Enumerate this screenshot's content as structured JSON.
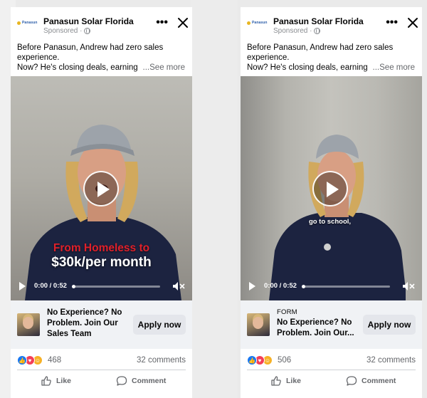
{
  "colors": {
    "brand_blue": "#1877f2",
    "overlay_red": "#e0202a",
    "secondary_text": "#65676b"
  },
  "cards": [
    {
      "logo_text": "Panasun",
      "advertiser": "Panasun Solar Florida",
      "sponsored": "Sponsored ·",
      "caption_lines": [
        "Before Panasun, Andrew had zero sales",
        "experience.",
        "Now? He's closing deals, earning"
      ],
      "see_more": "...See more",
      "video": {
        "overlay_red": "From Homeless to",
        "overlay_white": "$30k/per month",
        "subtitle": "",
        "time": "0:00 / 0:52"
      },
      "cta": {
        "kicker": "",
        "title_lines": [
          "No Experience? No",
          "Problem. Join Our",
          "Sales Team"
        ],
        "button": "Apply now"
      },
      "reactions": {
        "icons": [
          "like-icon",
          "love-icon",
          "haha-icon"
        ],
        "count": "468"
      },
      "comments": "32 comments",
      "actions": {
        "like": "Like",
        "comment": "Comment"
      }
    },
    {
      "logo_text": "Panasun",
      "advertiser": "Panasun Solar Florida",
      "sponsored": "Sponsored ·",
      "caption_lines": [
        "Before Panasun, Andrew had zero sales",
        "experience.",
        "Now? He's closing deals, earning"
      ],
      "see_more": "...See more",
      "video": {
        "overlay_red": "",
        "overlay_white": "",
        "subtitle": "go to school,",
        "time": "0:00 / 0:52"
      },
      "cta": {
        "kicker": "FORM",
        "title_lines": [
          "No Experience? No",
          "Problem. Join Our..."
        ],
        "button": "Apply now"
      },
      "reactions": {
        "icons": [
          "like-icon",
          "love-icon",
          "haha-icon"
        ],
        "count": "506"
      },
      "comments": "32 comments",
      "actions": {
        "like": "Like",
        "comment": "Comment"
      }
    }
  ]
}
